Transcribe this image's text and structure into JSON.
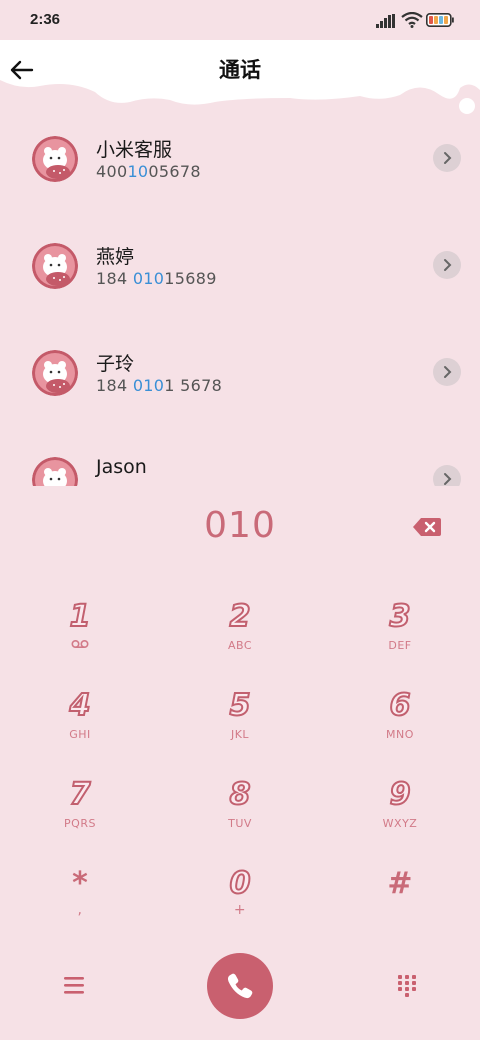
{
  "status_bar": {
    "time": "2:36"
  },
  "header": {
    "title": "通话"
  },
  "contacts": [
    {
      "name": "小米客服",
      "number_pre": "400",
      "number_hl": "10",
      "number_post": "05678",
      "number_pre_extra": ""
    },
    {
      "name": "燕婷",
      "number_pre": "184 ",
      "number_hl": "010",
      "number_post": "15689"
    },
    {
      "name": "子玲",
      "number_pre": "184 ",
      "number_hl": "010",
      "number_post": "1 5678"
    },
    {
      "name": "Jason",
      "number_pre": "",
      "number_hl": "",
      "number_post": ""
    }
  ],
  "dialer": {
    "input": "010",
    "keys": [
      {
        "digit": "1",
        "letters": ""
      },
      {
        "digit": "2",
        "letters": "ABC"
      },
      {
        "digit": "3",
        "letters": "DEF"
      },
      {
        "digit": "4",
        "letters": "GHI"
      },
      {
        "digit": "5",
        "letters": "JKL"
      },
      {
        "digit": "6",
        "letters": "MNO"
      },
      {
        "digit": "7",
        "letters": "PQRS"
      },
      {
        "digit": "8",
        "letters": "TUV"
      },
      {
        "digit": "9",
        "letters": "WXYZ"
      },
      {
        "digit": "*",
        "letters": ","
      },
      {
        "digit": "0",
        "letters": "+"
      },
      {
        "digit": "#",
        "letters": ""
      }
    ]
  },
  "icons": {
    "back": "back-arrow-icon",
    "backspace": "backspace-icon",
    "voicemail": "voicemail-icon",
    "menu": "menu-icon",
    "call": "phone-icon",
    "keypad": "keypad-icon"
  },
  "colors": {
    "accent": "#c9606f",
    "background": "#f6e1e6",
    "highlight": "#3a8fd6"
  }
}
